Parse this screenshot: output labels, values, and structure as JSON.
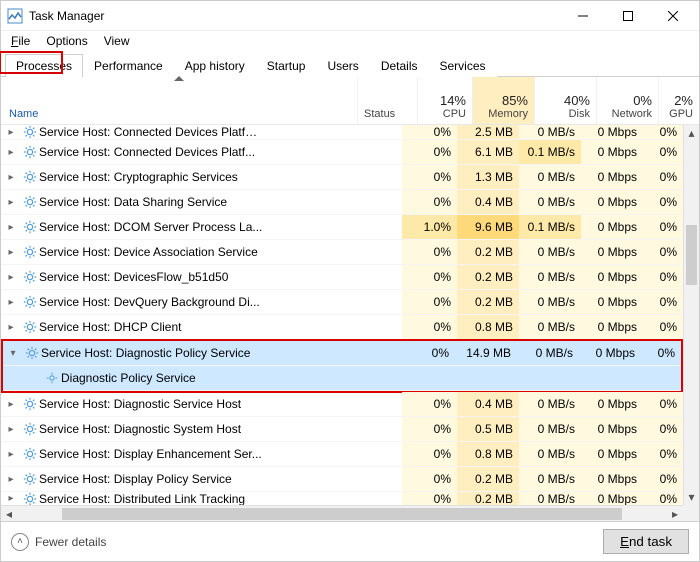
{
  "window": {
    "title": "Task Manager"
  },
  "menu": {
    "file": "File",
    "options": "Options",
    "view": "View"
  },
  "tabs": {
    "processes": "Processes",
    "performance": "Performance",
    "app_history": "App history",
    "startup": "Startup",
    "users": "Users",
    "details": "Details",
    "services": "Services"
  },
  "columns": {
    "name": "Name",
    "status": "Status",
    "cpu_pct": "14%",
    "cpu": "CPU",
    "mem_pct": "85%",
    "mem": "Memory",
    "disk_pct": "40%",
    "disk": "Disk",
    "net_pct": "0%",
    "net": "Network",
    "gpu_pct": "2%",
    "gpu": "GPU"
  },
  "rows": [
    {
      "name": "Service Host: Connected Devices Platf…",
      "cpu": "0%",
      "mem": "2.5 MB",
      "disk": "0 MB/s",
      "net": "0 Mbps",
      "gpu": "0%",
      "topcut": true
    },
    {
      "name": "Service Host: Connected Devices Platf...",
      "cpu": "0%",
      "mem": "6.1 MB",
      "disk": "0.1 MB/s",
      "net": "0 Mbps",
      "gpu": "0%",
      "diskhi": true
    },
    {
      "name": "Service Host: Cryptographic Services",
      "cpu": "0%",
      "mem": "1.3 MB",
      "disk": "0 MB/s",
      "net": "0 Mbps",
      "gpu": "0%"
    },
    {
      "name": "Service Host: Data Sharing Service",
      "cpu": "0%",
      "mem": "0.4 MB",
      "disk": "0 MB/s",
      "net": "0 Mbps",
      "gpu": "0%"
    },
    {
      "name": "Service Host: DCOM Server Process La...",
      "cpu": "1.0%",
      "mem": "9.6 MB",
      "disk": "0.1 MB/s",
      "net": "0 Mbps",
      "gpu": "0%",
      "cpuhi": true,
      "memhi": true,
      "diskhi": true
    },
    {
      "name": "Service Host: Device Association Service",
      "cpu": "0%",
      "mem": "0.2 MB",
      "disk": "0 MB/s",
      "net": "0 Mbps",
      "gpu": "0%"
    },
    {
      "name": "Service Host: DevicesFlow_b51d50",
      "cpu": "0%",
      "mem": "0.2 MB",
      "disk": "0 MB/s",
      "net": "0 Mbps",
      "gpu": "0%"
    },
    {
      "name": "Service Host: DevQuery Background Di...",
      "cpu": "0%",
      "mem": "0.2 MB",
      "disk": "0 MB/s",
      "net": "0 Mbps",
      "gpu": "0%"
    },
    {
      "name": "Service Host: DHCP Client",
      "cpu": "0%",
      "mem": "0.8 MB",
      "disk": "0 MB/s",
      "net": "0 Mbps",
      "gpu": "0%"
    }
  ],
  "selected": {
    "parent": {
      "name": "Service Host: Diagnostic Policy Service",
      "cpu": "0%",
      "mem": "14.9 MB",
      "disk": "0 MB/s",
      "net": "0 Mbps",
      "gpu": "0%"
    },
    "child": {
      "name": "Diagnostic Policy Service"
    }
  },
  "rows2": [
    {
      "name": "Service Host: Diagnostic Service Host",
      "cpu": "0%",
      "mem": "0.4 MB",
      "disk": "0 MB/s",
      "net": "0 Mbps",
      "gpu": "0%"
    },
    {
      "name": "Service Host: Diagnostic System Host",
      "cpu": "0%",
      "mem": "0.5 MB",
      "disk": "0 MB/s",
      "net": "0 Mbps",
      "gpu": "0%"
    },
    {
      "name": "Service Host: Display Enhancement Ser...",
      "cpu": "0%",
      "mem": "0.8 MB",
      "disk": "0 MB/s",
      "net": "0 Mbps",
      "gpu": "0%"
    },
    {
      "name": "Service Host: Display Policy Service",
      "cpu": "0%",
      "mem": "0.2 MB",
      "disk": "0 MB/s",
      "net": "0 Mbps",
      "gpu": "0%"
    },
    {
      "name": "Service Host: Distributed Link Tracking",
      "cpu": "0%",
      "mem": "0.2 MB",
      "disk": "0 MB/s",
      "net": "0 Mbps",
      "gpu": "0%",
      "botcut": true
    }
  ],
  "footer": {
    "fewer": "Fewer details",
    "endtask": "End task"
  }
}
